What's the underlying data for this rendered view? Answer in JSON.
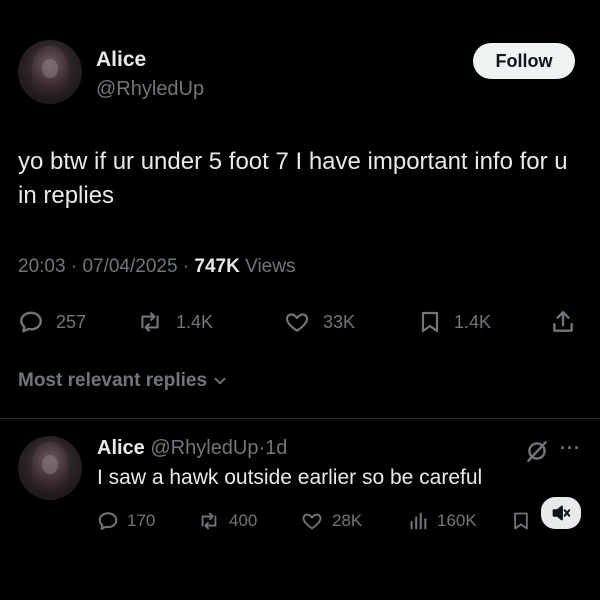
{
  "tweet": {
    "author_name": "Alice",
    "author_handle": "@RhyledUp",
    "follow_label": "Follow",
    "text": "yo btw if ur under 5 foot 7 I have important info for u in replies",
    "time": "20:03",
    "date": "07/04/2025",
    "views_count": "747K",
    "views_label": "Views",
    "separator": "·",
    "stats": {
      "replies": "257",
      "reposts": "1.4K",
      "likes": "33K",
      "bookmarks": "1.4K"
    }
  },
  "replies_section": {
    "label": "Most relevant replies"
  },
  "reply": {
    "author_name": "Alice",
    "author_handle": "@RhyledUp",
    "age": "1d",
    "separator": "·",
    "text": "I saw a hawk outside earlier so be careful",
    "more_label": "···",
    "stats": {
      "replies": "170",
      "reposts": "400",
      "likes": "28K",
      "views": "160K"
    }
  },
  "colors": {
    "background": "#000000",
    "text": "#e7e9ea",
    "muted": "#71767b",
    "divider": "#2f3336",
    "follow_bg": "#eff3f4"
  },
  "icons": [
    "reply-icon",
    "repost-icon",
    "like-icon",
    "bookmark-icon",
    "share-icon",
    "views-icon",
    "grok-slash-icon",
    "more-icon",
    "chevron-down-icon",
    "mute-icon"
  ]
}
